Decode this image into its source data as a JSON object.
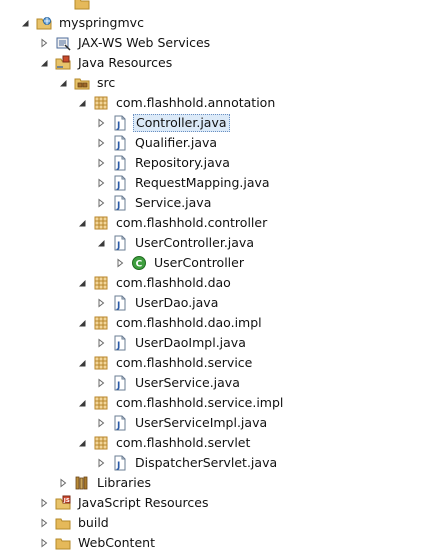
{
  "project_tree": {
    "items": [
      {
        "label": "",
        "icon": "folder-icon",
        "depth": 2,
        "twisty": "none",
        "state": "partial"
      },
      {
        "label": "myspringmvc",
        "icon": "web-project-icon",
        "depth": 0,
        "twisty": "expanded"
      },
      {
        "label": "JAX-WS Web Services",
        "icon": "web-services-icon",
        "depth": 1,
        "twisty": "collapsed"
      },
      {
        "label": "Java Resources",
        "icon": "java-resources-icon",
        "depth": 1,
        "twisty": "expanded"
      },
      {
        "label": "src",
        "icon": "source-folder-icon",
        "depth": 2,
        "twisty": "expanded"
      },
      {
        "label": "com.flashhold.annotation",
        "icon": "package-icon",
        "depth": 3,
        "twisty": "expanded"
      },
      {
        "label": "Controller.java",
        "icon": "java-file-icon",
        "depth": 4,
        "twisty": "collapsed",
        "selected": true
      },
      {
        "label": "Qualifier.java",
        "icon": "java-file-icon",
        "depth": 4,
        "twisty": "collapsed"
      },
      {
        "label": "Repository.java",
        "icon": "java-file-icon",
        "depth": 4,
        "twisty": "collapsed"
      },
      {
        "label": "RequestMapping.java",
        "icon": "java-file-icon",
        "depth": 4,
        "twisty": "collapsed"
      },
      {
        "label": "Service.java",
        "icon": "java-file-icon",
        "depth": 4,
        "twisty": "collapsed"
      },
      {
        "label": "com.flashhold.controller",
        "icon": "package-icon",
        "depth": 3,
        "twisty": "expanded"
      },
      {
        "label": "UserController.java",
        "icon": "java-file-icon",
        "depth": 4,
        "twisty": "expanded"
      },
      {
        "label": "UserController",
        "icon": "class-icon",
        "depth": 5,
        "twisty": "collapsed"
      },
      {
        "label": "com.flashhold.dao",
        "icon": "package-icon",
        "depth": 3,
        "twisty": "expanded"
      },
      {
        "label": "UserDao.java",
        "icon": "java-file-icon",
        "depth": 4,
        "twisty": "collapsed"
      },
      {
        "label": "com.flashhold.dao.impl",
        "icon": "package-icon",
        "depth": 3,
        "twisty": "expanded"
      },
      {
        "label": "UserDaoImpl.java",
        "icon": "java-file-icon",
        "depth": 4,
        "twisty": "collapsed"
      },
      {
        "label": "com.flashhold.service",
        "icon": "package-icon",
        "depth": 3,
        "twisty": "expanded"
      },
      {
        "label": "UserService.java",
        "icon": "java-file-icon",
        "depth": 4,
        "twisty": "collapsed"
      },
      {
        "label": "com.flashhold.service.impl",
        "icon": "package-icon",
        "depth": 3,
        "twisty": "expanded"
      },
      {
        "label": "UserServiceImpl.java",
        "icon": "java-file-icon",
        "depth": 4,
        "twisty": "collapsed"
      },
      {
        "label": "com.flashhold.servlet",
        "icon": "package-icon",
        "depth": 3,
        "twisty": "expanded"
      },
      {
        "label": "DispatcherServlet.java",
        "icon": "java-file-icon",
        "depth": 4,
        "twisty": "collapsed"
      },
      {
        "label": "Libraries",
        "icon": "libraries-icon",
        "depth": 2,
        "twisty": "collapsed"
      },
      {
        "label": "JavaScript Resources",
        "icon": "javascript-resources-icon",
        "depth": 1,
        "twisty": "collapsed"
      },
      {
        "label": "build",
        "icon": "folder-icon",
        "depth": 1,
        "twisty": "collapsed"
      },
      {
        "label": "WebContent",
        "icon": "folder-icon",
        "depth": 1,
        "twisty": "collapsed"
      },
      {
        "label": "",
        "icon": "web-project-icon",
        "depth": 0,
        "twisty": "collapsed",
        "state": "partial"
      }
    ]
  },
  "colors": {
    "selection_bg": "#dceaf8",
    "selection_border": "#6a8fc1",
    "package": "#b8862b",
    "java_blue": "#2a5aa7",
    "class_green": "#3e9f3e",
    "folder": "#e5b95a"
  }
}
